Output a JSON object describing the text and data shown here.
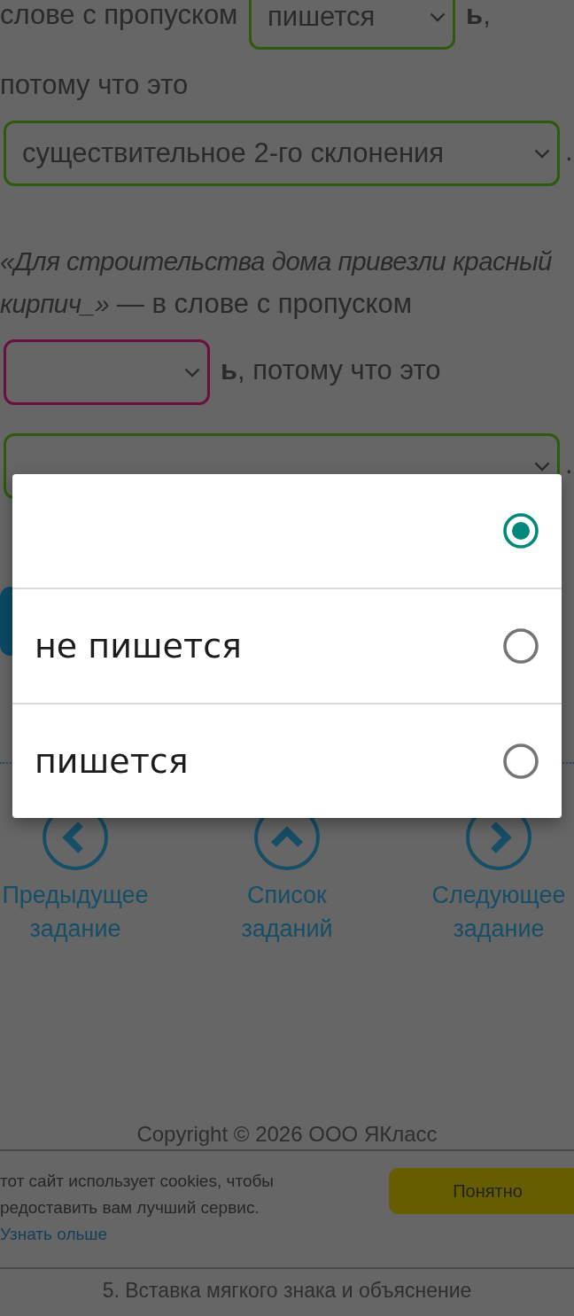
{
  "exercise": {
    "paragraphs": [
      {
        "parts": [
          {
            "kind": "text",
            "text": "слове с пропуском"
          },
          {
            "kind": "select",
            "value": "пишется",
            "color": "#2d5b0d"
          },
          {
            "kind": "text",
            "text": "**ь**,"
          },
          {
            "kind": "text",
            "text": "потому что это"
          },
          {
            "kind": "wideselect",
            "value": "существительное 2-го склонения",
            "color": "#2d5b0d"
          },
          {
            "kind": "text",
            "text": "."
          }
        ]
      },
      {
        "parts": [
          {
            "kind": "text",
            "text": "*«Для строительства дома привезли красный кирпич_»* — в слове с пропуском"
          },
          {
            "kind": "select",
            "color": "#6a0f40"
          },
          {
            "kind": "text",
            "text": "**ь**, потому что это"
          },
          {
            "kind": "wideselect",
            "color": "#2d5b0d"
          },
          {
            "kind": "text",
            "text": "."
          }
        ]
      }
    ]
  },
  "dropdown_menu": {
    "options": [
      {
        "selected": true
      },
      {
        "label": "не пишется",
        "selected": false
      },
      {
        "label": "пишется",
        "selected": false
      }
    ]
  },
  "task_nav": [
    {
      "kind": "back",
      "label": "Предыдущее задание"
    },
    {
      "kind": "up",
      "label": "Список заданий"
    },
    {
      "kind": "forward",
      "label": "Следующее задание"
    }
  ],
  "copyright": "Copyright © 2026 ООО ЯКласс",
  "cookie_banner": {
    "text": "тот сайт использует cookies, чтобы редоставить вам лучший сервис.",
    "link": "Узнать ольше",
    "button": "Понятно"
  },
  "page_title": "5. Вставка мягкого знака и объяснение"
}
